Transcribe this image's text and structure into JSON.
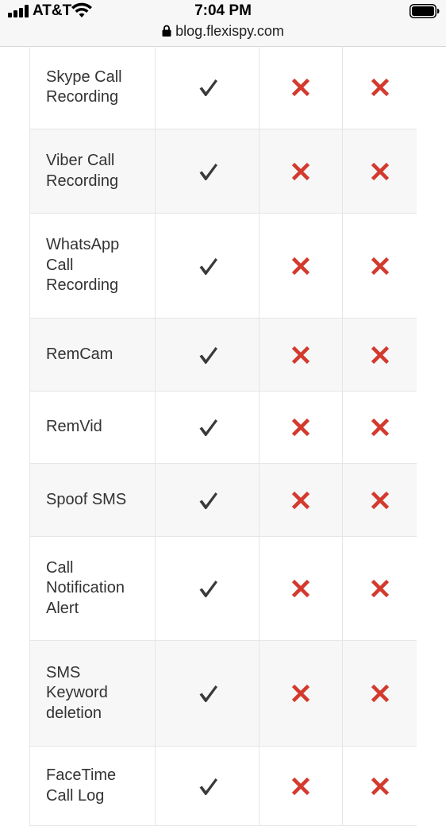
{
  "status_bar": {
    "carrier": "AT&T",
    "time": "7:04 PM",
    "url": "blog.flexispy.com",
    "icons": [
      "signal-icon",
      "wifi-icon",
      "battery-icon",
      "lock-icon"
    ]
  },
  "table": {
    "rows": [
      {
        "feature": "Skype Call\nRecording",
        "col2": "check",
        "col3": "cross",
        "col4": "cross"
      },
      {
        "feature": "Viber Call\nRecording",
        "col2": "check",
        "col3": "cross",
        "col4": "cross"
      },
      {
        "feature": "WhatsApp\nCall\nRecording",
        "col2": "check",
        "col3": "cross",
        "col4": "cross"
      },
      {
        "feature": "RemCam",
        "col2": "check",
        "col3": "cross",
        "col4": "cross"
      },
      {
        "feature": "RemVid",
        "col2": "check",
        "col3": "cross",
        "col4": "cross"
      },
      {
        "feature": "Spoof SMS",
        "col2": "check",
        "col3": "cross",
        "col4": "cross"
      },
      {
        "feature": "Call\nNotification\nAlert",
        "col2": "check",
        "col3": "cross",
        "col4": "cross"
      },
      {
        "feature": "SMS\nKeyword\ndeletion",
        "col2": "check",
        "col3": "cross",
        "col4": "cross"
      },
      {
        "feature": "FaceTime\nCall Log",
        "col2": "check",
        "col3": "cross",
        "col4": "cross"
      }
    ]
  },
  "colors": {
    "check": "#3a3a3a",
    "cross": "#d33a2e",
    "row_alt_bg": "#f7f7f7",
    "border": "#e6e6e6"
  }
}
